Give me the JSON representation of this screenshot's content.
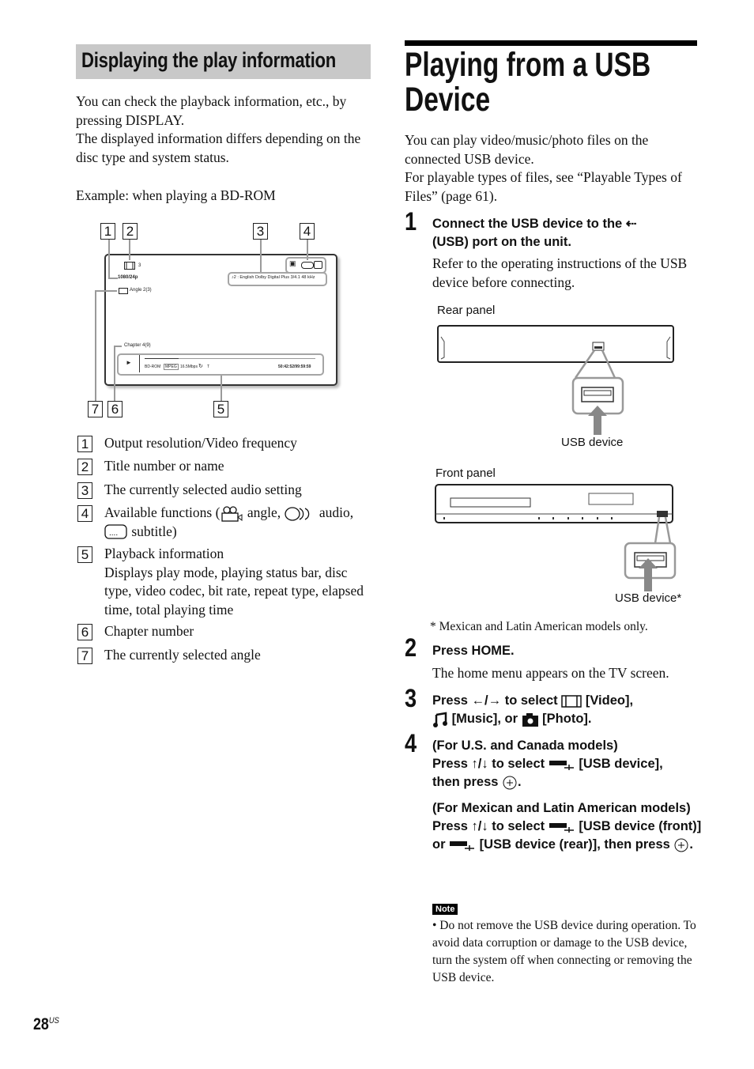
{
  "left": {
    "section_title": "Displaying the play information",
    "intro": [
      "You can check the playback information, etc., by pressing DISPLAY.",
      "The displayed information differs depending on the disc type and system status."
    ],
    "example": "Example: when playing a BD-ROM",
    "diagram": {
      "callouts": [
        "1",
        "2",
        "3",
        "4",
        "5",
        "6",
        "7"
      ],
      "title_number": "3",
      "resolution": "1080/24p",
      "angle": "Angle  2(3)",
      "audio": "2 : English  Dolby Digital Plus  3/4.1 48 kHz",
      "chapter": "Chapter 4(9)",
      "disc_type": "BD-ROM",
      "codec": "MPEG",
      "bitrate": "16.5Mbps",
      "repeat": "T",
      "time": "50:42:52/99:59:59",
      "progress": 0.2
    },
    "legend": [
      {
        "num": "1",
        "text": "Output resolution/Video frequency"
      },
      {
        "num": "2",
        "text": "Title number or name"
      },
      {
        "num": "3",
        "text": "The currently selected audio setting"
      },
      {
        "num": "4",
        "text_a": "Available functions (",
        "text_b": " angle, ",
        "text_c": " audio,",
        "text_d": " subtitle)"
      },
      {
        "num": "5",
        "text": "Playback information",
        "sub": "Displays play mode, playing status bar, disc type, video codec, bit rate, repeat type, elapsed time, total playing time"
      },
      {
        "num": "6",
        "text": "Chapter number"
      },
      {
        "num": "7",
        "text": "The currently selected angle"
      }
    ]
  },
  "right": {
    "title_line1": "Playing from a USB",
    "title_line2": "Device",
    "intro": [
      "You can play video/music/photo files on the connected USB device.",
      "For playable types of files, see “Playable Types of Files” (page 61)."
    ],
    "steps": [
      {
        "num": "1",
        "title_a": "Connect the USB device to the ",
        "title_b": "(USB) port on the unit.",
        "body": "Refer to the operating instructions of the USB device before connecting."
      },
      {
        "num": "2",
        "title": "Press HOME.",
        "body": "The home menu appears on the TV screen."
      },
      {
        "num": "3",
        "title_a": "Press ←/→ to select ",
        "title_b": " [Video],",
        "title_c": " [Music], or ",
        "title_d": " [Photo]."
      },
      {
        "num": "4",
        "title_a": "(For U.S. and Canada models)",
        "title_b": "Press ↑/↓ to select ",
        "title_c": " [USB device],",
        "title_d": "then press ",
        "title_e": ".",
        "alt_a": "(For Mexican and Latin American models)",
        "alt_b": "Press ↑/↓ to select ",
        "alt_c": " [USB device (front)] or ",
        "alt_d": " [USB device (rear)], then press ",
        "alt_e": "."
      }
    ],
    "diagram": {
      "rear_label": "Rear panel",
      "rear_usb_label": "USB device",
      "front_label": "Front panel",
      "front_usb_label": "USB device*",
      "footnote": "*  Mexican and Latin American models only."
    },
    "note_label": "Note",
    "note_text": "• Do not remove the USB device during operation. To avoid data corruption or damage to the USB device, turn the system off when connecting or removing the USB device."
  },
  "page": {
    "number": "28",
    "suffix": "US"
  }
}
